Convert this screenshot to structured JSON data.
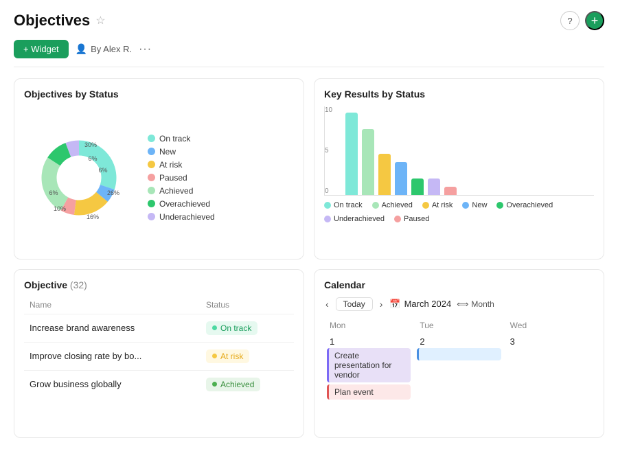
{
  "header": {
    "title": "Objectives",
    "star_icon": "☆",
    "help_icon": "?",
    "add_icon": "+"
  },
  "toolbar": {
    "widget_label": "+ Widget",
    "user_label": "By Alex R.",
    "dots": "···"
  },
  "objectives_by_status": {
    "title": "Objectives by Status",
    "segments": [
      {
        "label": "On track",
        "color": "#7ee8d8",
        "percent": 30,
        "pct_label": "30%"
      },
      {
        "label": "New",
        "color": "#6db4f7",
        "percent": 6,
        "pct_label": "6%"
      },
      {
        "label": "At risk",
        "color": "#f5c842",
        "percent": 16,
        "pct_label": "16%"
      },
      {
        "label": "Paused",
        "color": "#f5a0a0",
        "percent": 6,
        "pct_label": "6%"
      },
      {
        "label": "Achieved",
        "color": "#a8e6b8",
        "percent": 26,
        "pct_label": "26%"
      },
      {
        "label": "Overachieved",
        "color": "#2dc76d",
        "percent": 10,
        "pct_label": "10%"
      },
      {
        "label": "Underachieved",
        "color": "#c5b8f5",
        "percent": 6,
        "pct_label": "6%"
      }
    ]
  },
  "key_results_by_status": {
    "title": "Key Results by Status",
    "y_labels": [
      "0",
      "5",
      "10"
    ],
    "groups": [
      {
        "status": "On track",
        "value": 10,
        "color": "#7ee8d8"
      },
      {
        "status": "Achieved",
        "value": 8,
        "color": "#a8e6b8"
      },
      {
        "status": "At risk",
        "value": 5,
        "color": "#f5c842"
      },
      {
        "status": "New",
        "value": 4,
        "color": "#6db4f7"
      },
      {
        "status": "Overachieved",
        "value": 2,
        "color": "#2dc76d"
      },
      {
        "status": "Underachieved",
        "value": 2,
        "color": "#c5b8f5"
      },
      {
        "status": "Paused",
        "value": 1,
        "color": "#f5a0a0"
      }
    ],
    "legend": [
      {
        "label": "On track",
        "color": "#7ee8d8"
      },
      {
        "label": "Achieved",
        "color": "#a8e6b8"
      },
      {
        "label": "At risk",
        "color": "#f5c842"
      },
      {
        "label": "New",
        "color": "#6db4f7"
      },
      {
        "label": "Overachieved",
        "color": "#2dc76d"
      },
      {
        "label": "Underachieved",
        "color": "#c5b8f5"
      },
      {
        "label": "Paused",
        "color": "#f5a0a0"
      }
    ]
  },
  "objectives_list": {
    "title": "Objective",
    "count": "(32)",
    "col_name": "Name",
    "col_status": "Status",
    "rows": [
      {
        "name": "Increase brand awareness",
        "status": "On track",
        "status_key": "ontrack"
      },
      {
        "name": "Improve closing rate by bo...",
        "status": "At risk",
        "status_key": "atrisk"
      },
      {
        "name": "Grow business globally",
        "status": "Achieved",
        "status_key": "achieved"
      }
    ]
  },
  "calendar": {
    "title": "Calendar",
    "today_label": "Today",
    "month_label": "March 2024",
    "view_label": "Month",
    "days": [
      "Mon",
      "Tue",
      "Wed"
    ],
    "dates": [
      "1",
      "2",
      "3"
    ],
    "events": [
      {
        "col": 1,
        "label": "Create presentation for vendor",
        "type": "purple"
      },
      {
        "col": 1,
        "label": "Plan event",
        "type": "red"
      },
      {
        "col": 2,
        "label": "",
        "type": "blue"
      }
    ]
  }
}
